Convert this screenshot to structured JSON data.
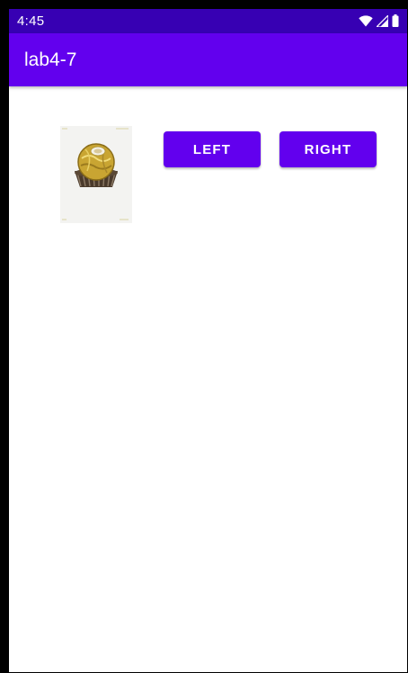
{
  "status_bar": {
    "time": "4:45",
    "icons": [
      "wifi-icon",
      "signal-icon",
      "battery-icon"
    ]
  },
  "app_bar": {
    "title": "lab4-7"
  },
  "image": {
    "subject": "foil-wrapped chocolate praline in brown paper cup"
  },
  "buttons": {
    "left_label": "LEFT",
    "right_label": "RIGHT"
  },
  "colors": {
    "status_bar": "#3700b3",
    "primary": "#6200ee",
    "on_primary": "#ffffff",
    "background": "#ffffff"
  }
}
